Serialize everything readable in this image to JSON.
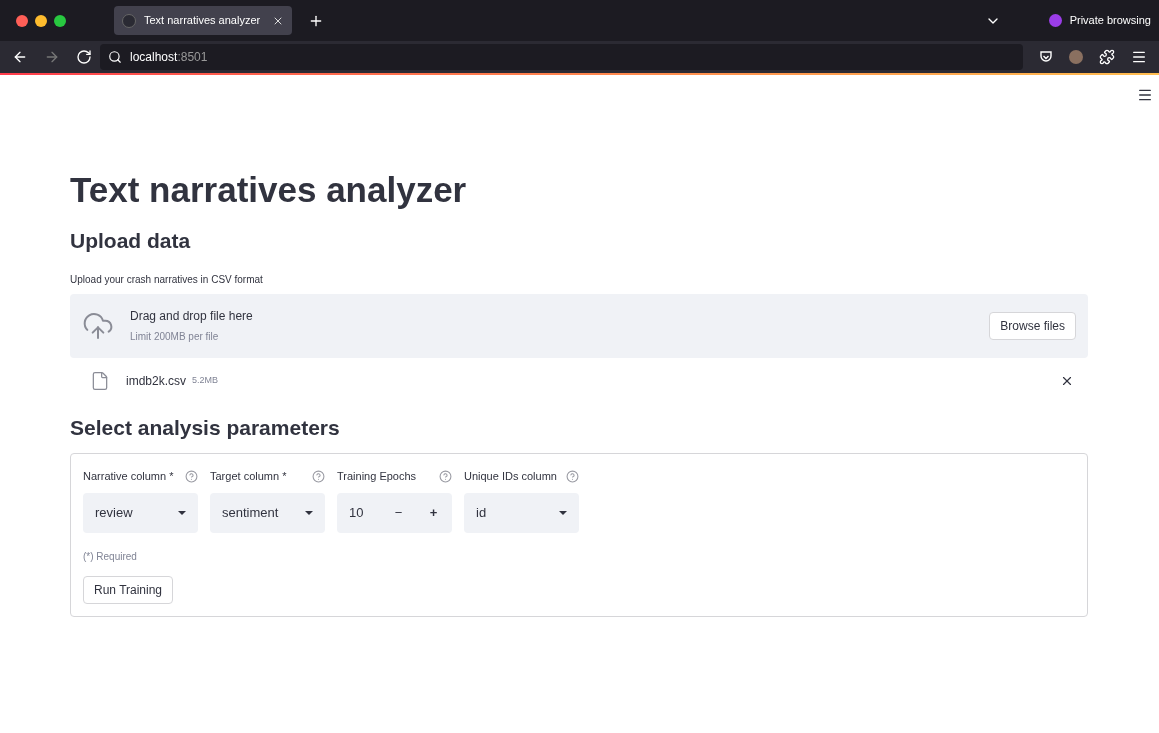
{
  "browser": {
    "tab": {
      "title": "Text narratives analyzer",
      "selected": true
    },
    "private_label": "Private browsing",
    "url": {
      "host": "localhost",
      "port": ":8501"
    }
  },
  "page": {
    "title": "Text narratives analyzer",
    "upload": {
      "heading": "Upload data",
      "label": "Upload your crash narratives in CSV format",
      "dropzone": {
        "title": "Drag and drop file here",
        "hint": "Limit 200MB per file",
        "button": "Browse files"
      },
      "files": [
        {
          "name": "imdb2k.csv",
          "size": "5.2MB"
        }
      ]
    },
    "parameters": {
      "heading": "Select analysis parameters",
      "fields": [
        {
          "kind": "select",
          "label": "Narrative column *",
          "value": "review"
        },
        {
          "kind": "select",
          "label": "Target column *",
          "value": "sentiment"
        },
        {
          "kind": "number",
          "label": "Training Epochs",
          "value": "10",
          "decrement": "−",
          "increment": "+"
        },
        {
          "kind": "select",
          "label": "Unique IDs column",
          "value": "id"
        }
      ],
      "note": "(*) Required",
      "button": "Run Training"
    }
  }
}
